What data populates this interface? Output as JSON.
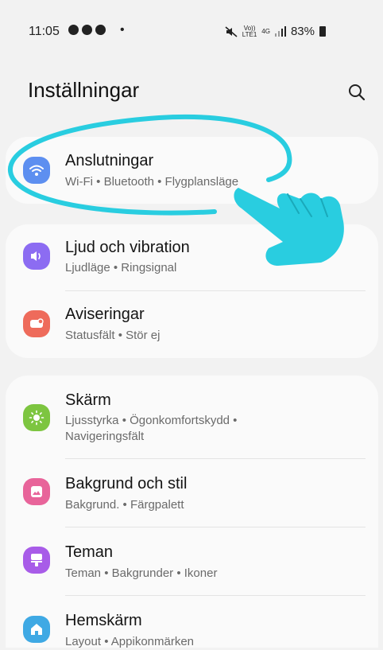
{
  "status_bar": {
    "time": "11:05",
    "bullet": "•",
    "volte_text": "Vo))\nLTE1",
    "network_text": "4G",
    "battery_percent": "83%"
  },
  "header": {
    "title": "Inställningar",
    "search_icon": "search-icon"
  },
  "groups": [
    {
      "items": [
        {
          "title": "Anslutningar",
          "subtitle": "Wi-Fi • Bluetooth • Flygplansläge",
          "icon": "wifi-icon",
          "color": "#5d8ff0"
        }
      ]
    },
    {
      "items": [
        {
          "title": "Ljud och vibration",
          "subtitle": "Ljudläge • Ringsignal",
          "icon": "sound-icon",
          "color": "#8c6cf2"
        },
        {
          "title": "Aviseringar",
          "subtitle": "Statusfält • Stör ej",
          "icon": "notification-icon",
          "color": "#ee6b5b"
        }
      ]
    },
    {
      "items": [
        {
          "title": "Skärm",
          "subtitle": "Ljusstyrka • Ögonkomfortskydd • Navigeringsfält",
          "icon": "display-icon",
          "color": "#7dc540"
        },
        {
          "title": "Bakgrund och stil",
          "subtitle": "Bakgrund. • Färgpalett",
          "icon": "wallpaper-icon",
          "color": "#e8649a"
        },
        {
          "title": "Teman",
          "subtitle": "Teman • Bakgrunder • Ikoner",
          "icon": "themes-icon",
          "color": "#a85ce8"
        },
        {
          "title": "Hemskärm",
          "subtitle": "Layout • Appikonmärken",
          "icon": "home-icon",
          "color": "#3fa9e4"
        }
      ]
    }
  ],
  "annotation_colors": {
    "highlight": "#29cde0"
  }
}
